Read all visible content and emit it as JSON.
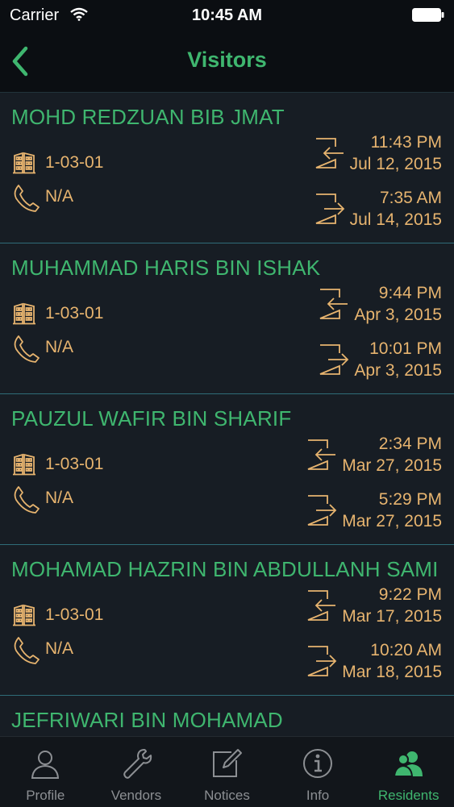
{
  "status_bar": {
    "carrier": "Carrier",
    "time": "10:45 AM"
  },
  "nav": {
    "title": "Visitors"
  },
  "visitors": [
    {
      "name": "MOHD REDZUAN BIB JMAT",
      "unit": "1-03-01",
      "phone": "N/A",
      "in_time": "11:43 PM",
      "in_date": "Jul 12, 2015",
      "out_time": "7:35 AM",
      "out_date": "Jul 14, 2015"
    },
    {
      "name": "MUHAMMAD HARIS BIN ISHAK",
      "unit": "1-03-01",
      "phone": "N/A",
      "in_time": "9:44 PM",
      "in_date": "Apr 3, 2015",
      "out_time": "10:01 PM",
      "out_date": "Apr 3, 2015"
    },
    {
      "name": "PAUZUL WAFIR BIN SHARIF",
      "unit": "1-03-01",
      "phone": "N/A",
      "in_time": "2:34 PM",
      "in_date": "Mar 27, 2015",
      "out_time": "5:29 PM",
      "out_date": "Mar 27, 2015"
    },
    {
      "name": "MOHAMAD HAZRIN BIN ABDULLANH SAMI",
      "unit": "1-03-01",
      "phone": "N/A",
      "in_time": "9:22 PM",
      "in_date": "Mar 17, 2015",
      "out_time": "10:20 AM",
      "out_date": "Mar 18, 2015"
    },
    {
      "name": "JEFRIWARI BIN MOHAMAD",
      "unit": "",
      "phone": "",
      "in_time": "",
      "in_date": "",
      "out_time": "",
      "out_date": ""
    }
  ],
  "tabs": [
    {
      "label": "Profile",
      "icon": "person-icon",
      "active": false
    },
    {
      "label": "Vendors",
      "icon": "wrench-icon",
      "active": false
    },
    {
      "label": "Notices",
      "icon": "edit-icon",
      "active": false
    },
    {
      "label": "Info",
      "icon": "info-icon",
      "active": false
    },
    {
      "label": "Residents",
      "icon": "residents-icon",
      "active": true
    }
  ],
  "colors": {
    "accent_green": "#3fb66f",
    "text_amber": "#e7b46f",
    "row_background": "#171d24",
    "divider_teal": "#2f6c78",
    "tab_inactive": "#8c8f93"
  }
}
